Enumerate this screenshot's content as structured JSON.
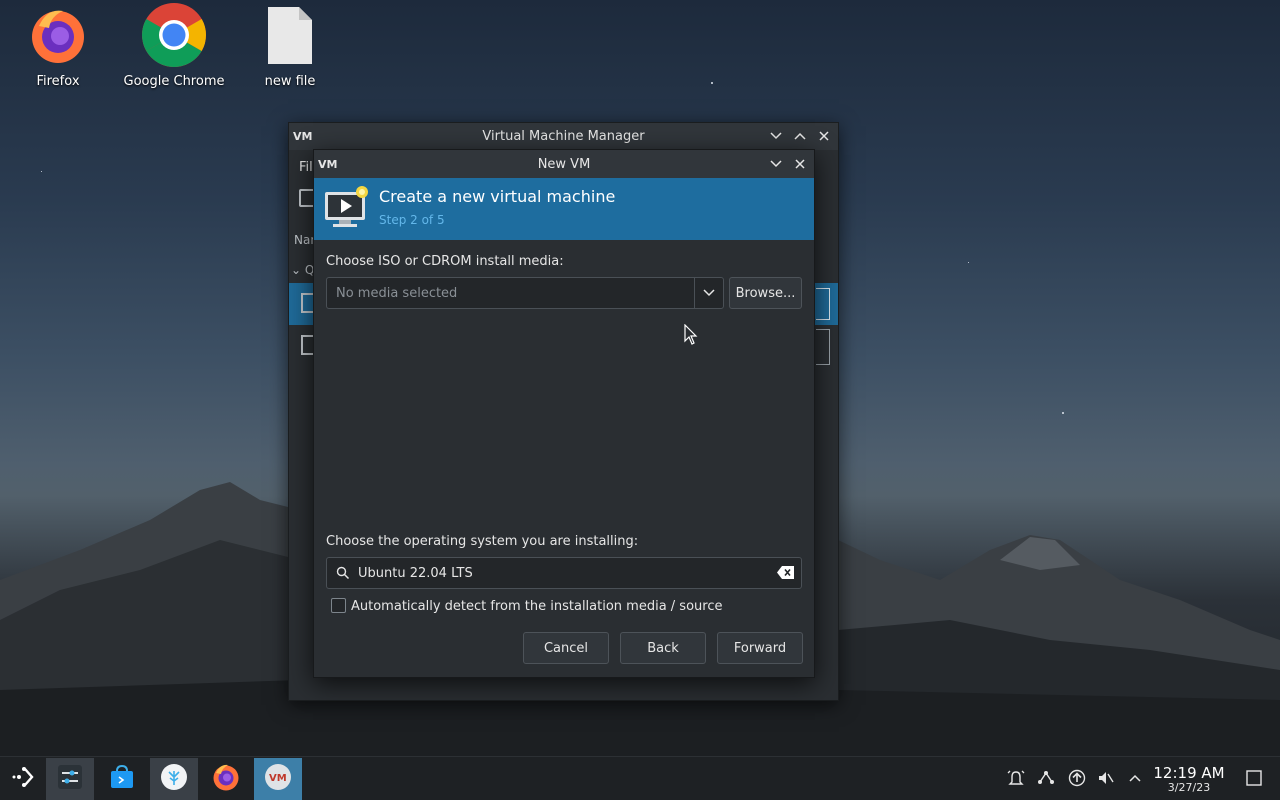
{
  "desktop": {
    "icons": [
      {
        "label": "Firefox",
        "icon": "firefox-icon"
      },
      {
        "label": "Google Chrome",
        "icon": "chrome-icon"
      },
      {
        "label": "new file",
        "icon": "file-icon"
      }
    ]
  },
  "main_window": {
    "title": "Virtual Machine Manager",
    "menu_first": "File",
    "header_name": "Name",
    "group_label": "Q"
  },
  "dialog": {
    "title": "New VM",
    "banner_title": "Create a new virtual machine",
    "banner_step": "Step 2 of 5",
    "iso_label": "Choose ISO or CDROM install media:",
    "iso_placeholder": "No media selected",
    "browse_label": "Browse...",
    "os_label": "Choose the operating system you are installing:",
    "os_value": "Ubuntu 22.04 LTS",
    "auto_detect_label": "Automatically detect from the installation media / source",
    "auto_detect_checked": false,
    "cancel_label": "Cancel",
    "back_label": "Back",
    "forward_label": "Forward"
  },
  "taskbar": {
    "apps": [
      "launcher-icon",
      "system-settings-icon",
      "discover-store-icon",
      "files-icon",
      "firefox-icon",
      "virt-manager-icon"
    ],
    "time": "12:19 AM",
    "date": "3/27/23"
  },
  "colors": {
    "accent": "#1e6d9f",
    "window_bg": "#2a2e32",
    "titlebar": "#31363b",
    "taskbar": "#1e2124"
  }
}
